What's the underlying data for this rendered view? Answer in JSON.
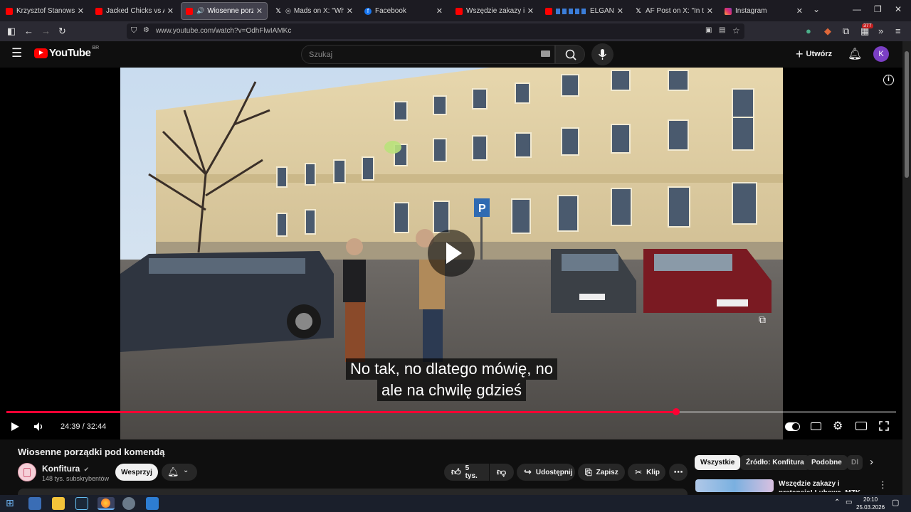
{
  "browser": {
    "tabs": [
      {
        "title": "Krzysztof Stanowski. W j",
        "favicon": "youtube-favicon",
        "active": false
      },
      {
        "title": "Jacked Chicks vs Average",
        "favicon": "youtube-favicon",
        "active": false
      },
      {
        "title": "Wiosenne porządki p",
        "favicon": "youtube-favicon",
        "active": true
      },
      {
        "title": "Mads on X: \"When th",
        "favicon": "x-favicon",
        "active": false
      },
      {
        "title": "Facebook",
        "favicon": "facebook-favicon",
        "active": false
      },
      {
        "title": "Wszędzie zakazy i preten",
        "favicon": "youtube-favicon",
        "active": false
      },
      {
        "title": "ELGANC",
        "favicon": "youtube-favicon",
        "active": false
      },
      {
        "title": "AF Post on X: \"In the first",
        "favicon": "x-favicon",
        "active": false
      },
      {
        "title": "Instagram",
        "favicon": "instagram-favicon",
        "active": false
      }
    ],
    "url": "www.youtube.com/watch?v=OdhFlwIAMKc",
    "extension_badge": "377"
  },
  "youtube": {
    "logo_text": "YouTube",
    "logo_country": "BR",
    "search_placeholder": "Szukaj",
    "create_label": "Utwórz",
    "avatar_letter": "K"
  },
  "player": {
    "subtitle_line1": "No tak, no dlatego mówię, no",
    "subtitle_line2": "ale na chwilę gdzieś",
    "time_display": "24:39 / 32:44",
    "progress_fraction": 0.753,
    "progress_color": "#ff0033"
  },
  "video": {
    "title": "Wiosenne porządki pod komendą",
    "channel_name": "Konfitura",
    "subscribers": "148 tys. subskrybentów",
    "join_label": "Wesprzyj",
    "likes_label": "5 tys.",
    "share_label": "Udostępnij",
    "save_label": "Zapisz",
    "clip_label": "Klip"
  },
  "recommendations": {
    "chips": [
      {
        "label": "Wszystkie",
        "selected": true
      },
      {
        "label": "Źródło: Konfitura",
        "selected": false
      },
      {
        "label": "Podobne",
        "selected": false
      },
      {
        "label": "Dl",
        "selected": false
      }
    ],
    "first_title": "Wszędzie zakazy i pretensje! Lubawa, MZK, zajezdnia"
  },
  "taskbar": {
    "time": "20:10",
    "date": "25.03.2026"
  }
}
